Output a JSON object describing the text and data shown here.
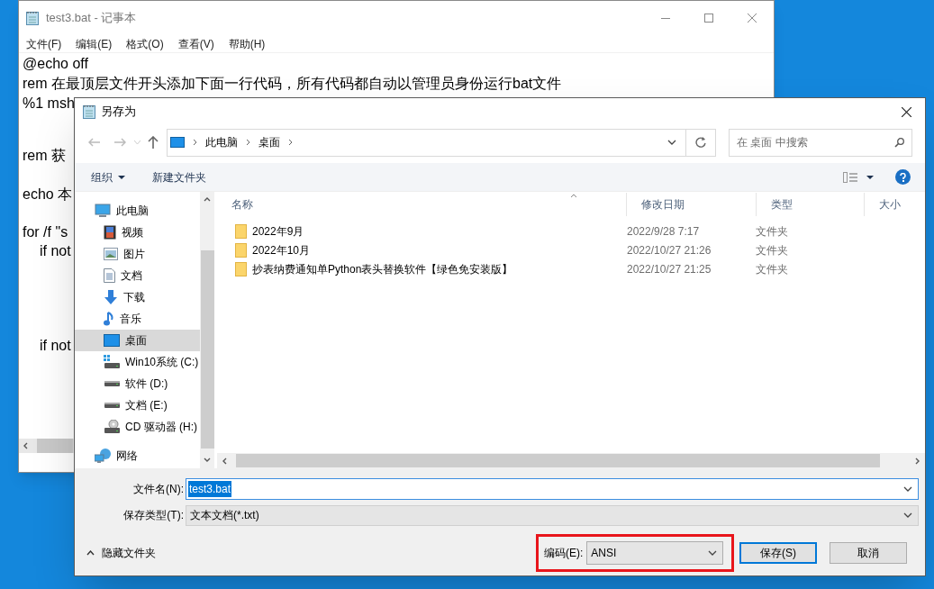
{
  "notepad": {
    "title": "test3.bat - 记事本",
    "menu": [
      "文件(F)",
      "编辑(E)",
      "格式(O)",
      "查看(V)",
      "帮助(H)"
    ],
    "top_lines": [
      "@echo off",
      "rem 在最顶层文件开头添加下面一行代码，所有代码都自动以管理员身份运行bat文件",
      "%1 msh"
    ],
    "side_lines": [
      {
        "text": "rem 获",
        "indented": false
      },
      {
        "text": "echo 本",
        "indented": false
      },
      {
        "text": "for /f \"s",
        "indented": false
      },
      {
        "text": "if not",
        "indented": true
      },
      {
        "text": "if not",
        "indented": true
      }
    ]
  },
  "dialog": {
    "title": "另存为",
    "breadcrumbs": [
      "此电脑",
      "桌面"
    ],
    "search": {
      "placeholder": "在 桌面 中搜索"
    },
    "toolbar": {
      "organize": "组织",
      "new_folder": "新建文件夹"
    },
    "nav": [
      {
        "label": "此电脑",
        "kind": "pc",
        "selected": false,
        "children": [
          {
            "label": "视频",
            "kind": "video",
            "selected": false
          },
          {
            "label": "图片",
            "kind": "picture",
            "selected": false
          },
          {
            "label": "文档",
            "kind": "document",
            "selected": false
          },
          {
            "label": "下载",
            "kind": "download",
            "selected": false
          },
          {
            "label": "音乐",
            "kind": "music",
            "selected": false
          },
          {
            "label": "桌面",
            "kind": "desktop",
            "selected": true
          },
          {
            "label": "Win10系统 (C:)",
            "kind": "system-drive",
            "selected": false
          },
          {
            "label": "软件 (D:)",
            "kind": "drive",
            "selected": false
          },
          {
            "label": "文档 (E:)",
            "kind": "drive",
            "selected": false
          },
          {
            "label": "CD 驱动器 (H:)",
            "kind": "cd",
            "selected": false
          }
        ]
      },
      {
        "label": "网络",
        "kind": "network",
        "selected": false
      }
    ],
    "columns": [
      "名称",
      "修改日期",
      "类型",
      "大小"
    ],
    "rows": [
      {
        "name": "2022年9月",
        "modified": "2022/9/28 7:17",
        "type": "文件夹"
      },
      {
        "name": "2022年10月",
        "modified": "2022/10/27 21:26",
        "type": "文件夹"
      },
      {
        "name": "抄表纳费通知单Python表头替换软件【绿色免安装版】",
        "modified": "2022/10/27 21:25",
        "type": "文件夹"
      }
    ],
    "file_name": {
      "label": "文件名(N):",
      "value": "test3.bat",
      "text_selected": true
    },
    "file_type": {
      "label": "保存类型(T):",
      "value": "文本文档(*.txt)"
    },
    "hide_folders": "隐藏文件夹",
    "encoding": {
      "label": "编码(E):",
      "value": "ANSI"
    },
    "buttons": [
      "保存(S)",
      "取消"
    ]
  }
}
